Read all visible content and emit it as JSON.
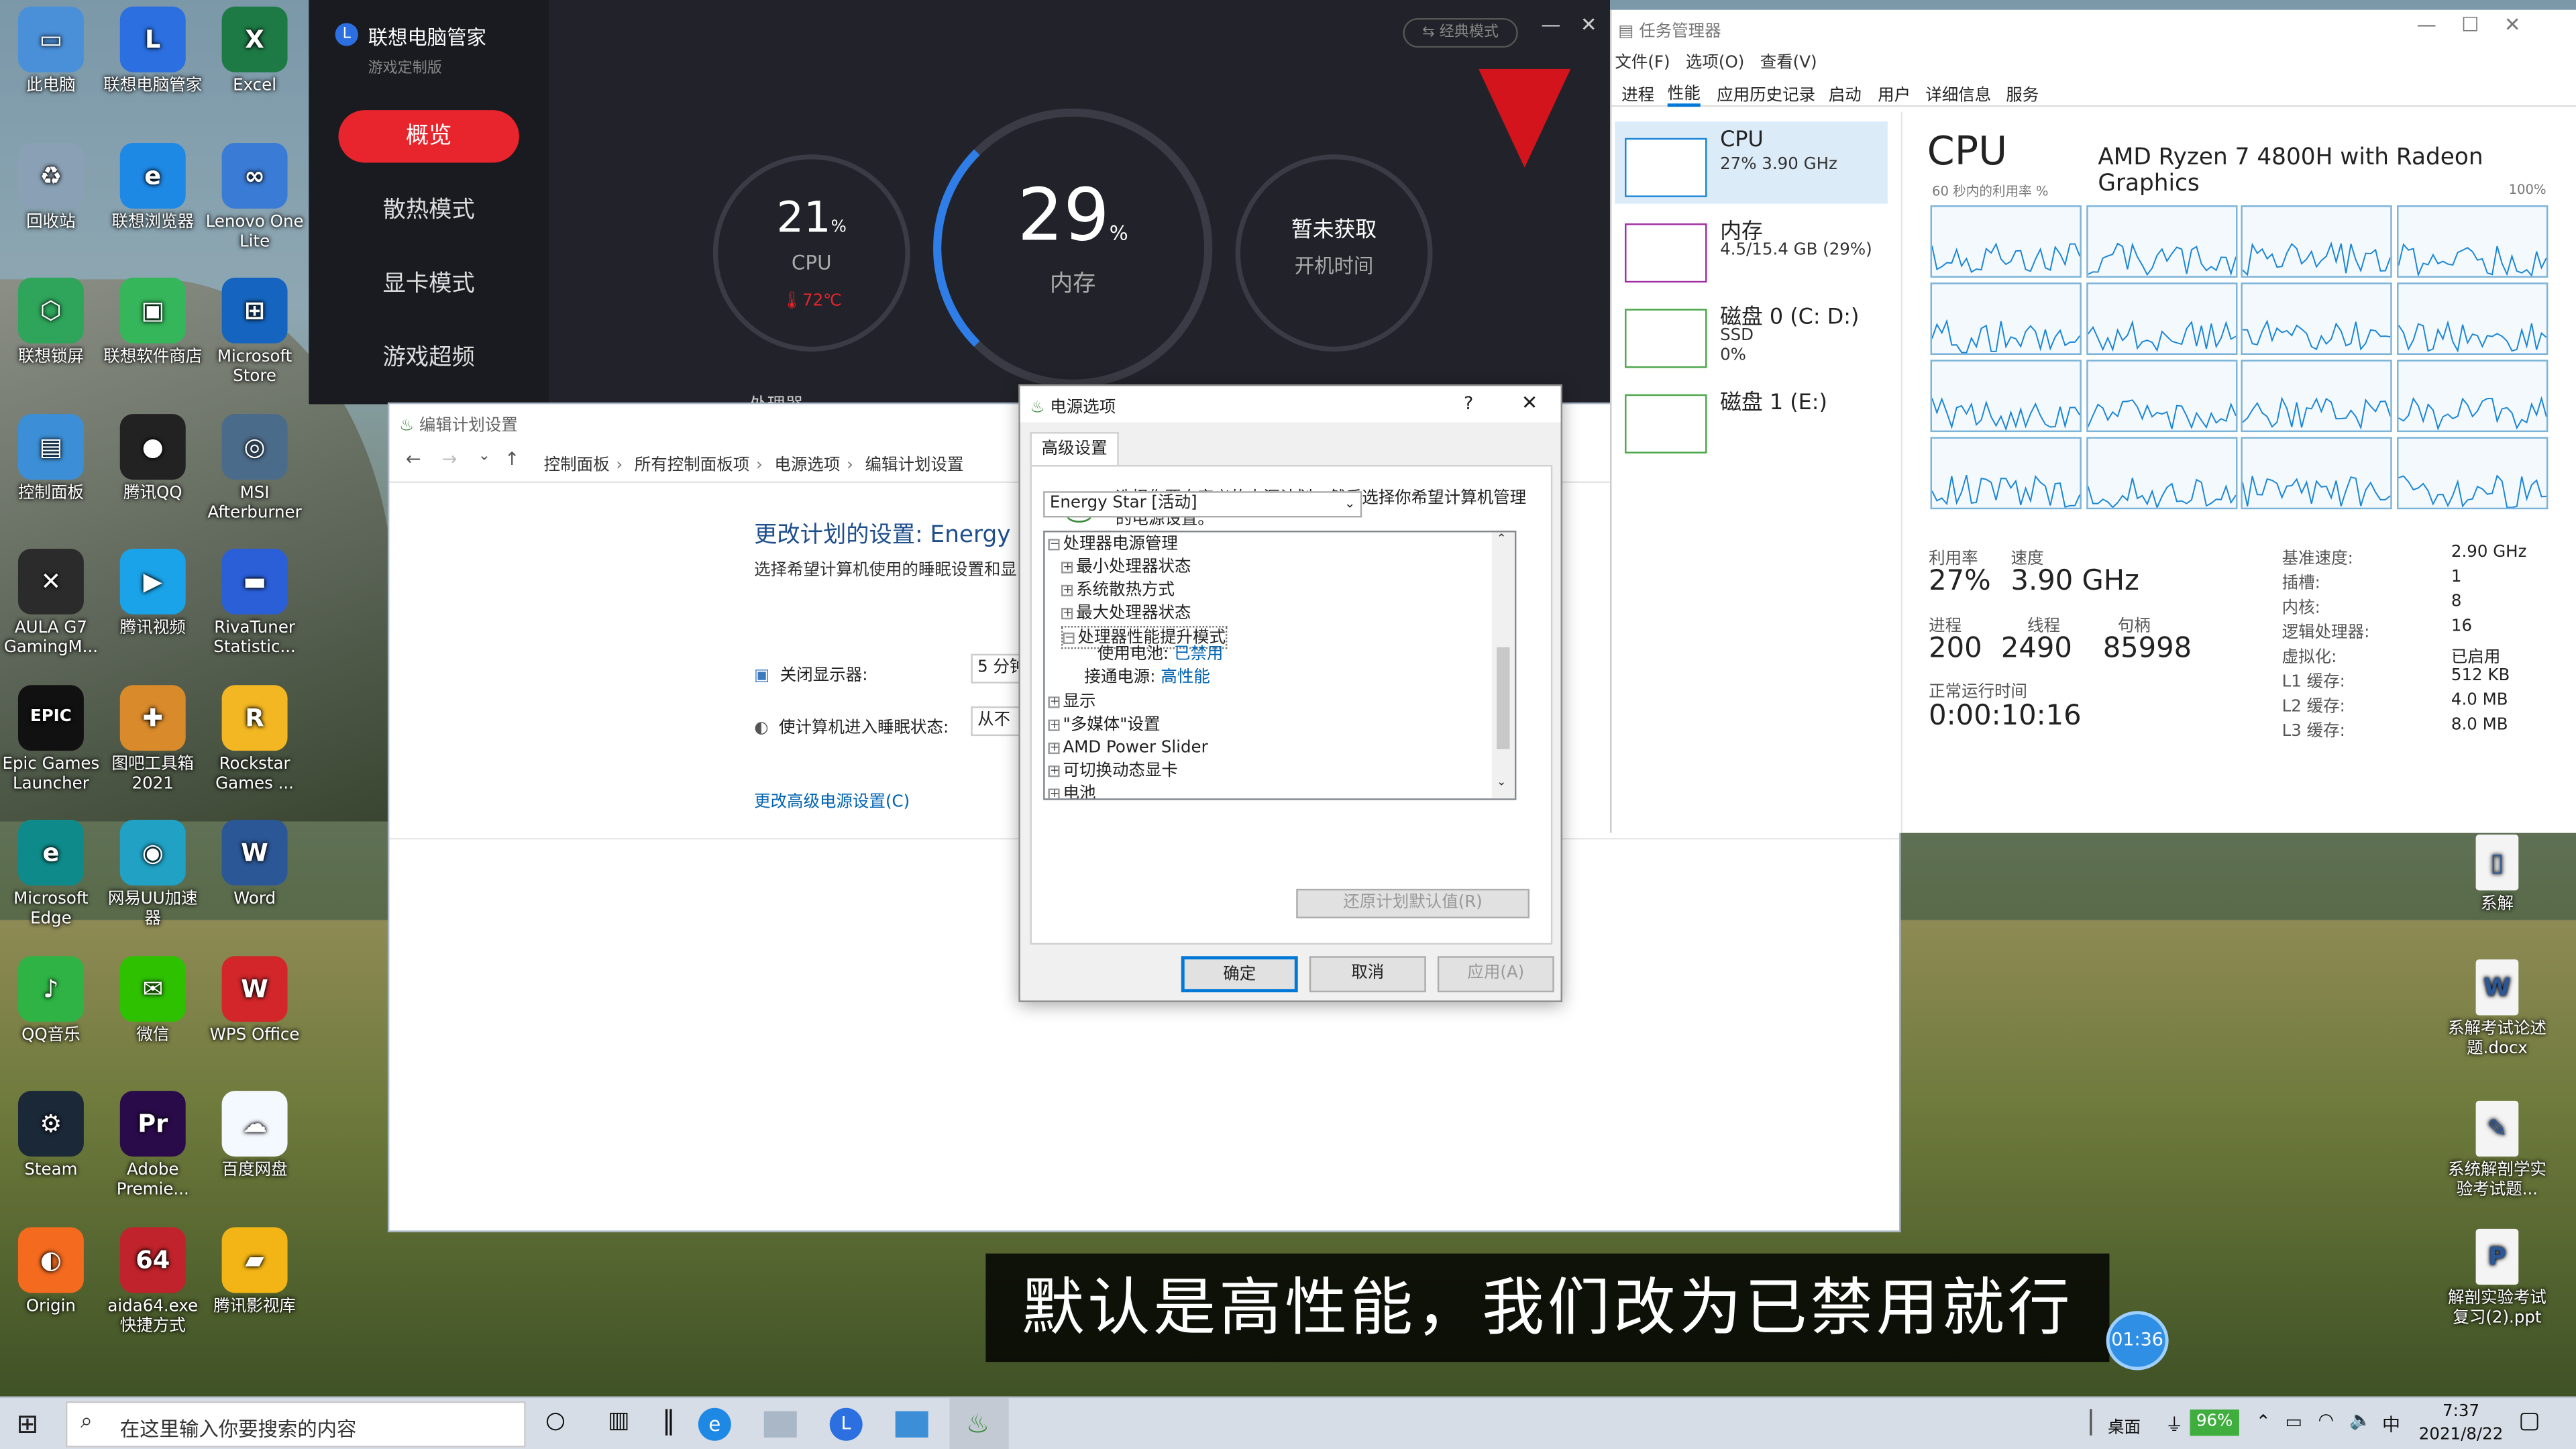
{
  "desktop_left": [
    {
      "label": "此电脑",
      "icon": "this-pc-icon",
      "color": "#4a90d9",
      "glyph": "▭"
    },
    {
      "label": "联想电脑管家",
      "icon": "lenovo-pcmanager-icon",
      "color": "#2b6fe0",
      "glyph": "L"
    },
    {
      "label": "Excel",
      "icon": "excel-icon",
      "color": "#1d7a44",
      "glyph": "X"
    },
    {
      "label": "回收站",
      "icon": "recycle-bin-icon",
      "color": "#8aa0b5",
      "glyph": "♻"
    },
    {
      "label": "联想浏览器",
      "icon": "lenovo-browser-icon",
      "color": "#1e88e5",
      "glyph": "e"
    },
    {
      "label": "Lenovo One Lite",
      "icon": "lenovo-one-icon",
      "color": "#3a7bd5",
      "glyph": "∞"
    },
    {
      "label": "联想锁屏",
      "icon": "lenovo-lock-icon",
      "color": "#2ea55a",
      "glyph": "⬡"
    },
    {
      "label": "联想软件商店",
      "icon": "lenovo-store-icon",
      "color": "#35b65a",
      "glyph": "▣"
    },
    {
      "label": "Microsoft Store",
      "icon": "ms-store-icon",
      "color": "#1565c0",
      "glyph": "⊞"
    },
    {
      "label": "控制面板",
      "icon": "control-panel-icon",
      "color": "#3c8fd6",
      "glyph": "▤"
    },
    {
      "label": "腾讯QQ",
      "icon": "qq-icon",
      "color": "#222",
      "glyph": "●"
    },
    {
      "label": "MSI Afterburner",
      "icon": "msi-afterburner-icon",
      "color": "#4b6b8a",
      "glyph": "◎"
    },
    {
      "label": "AULA G7 GamingM...",
      "icon": "aula-icon",
      "color": "#2b2b2b",
      "glyph": "✕"
    },
    {
      "label": "腾讯视频",
      "icon": "tencent-video-icon",
      "color": "#1aa3e8",
      "glyph": "▶"
    },
    {
      "label": "RivaTuner Statistic...",
      "icon": "rivatuner-icon",
      "color": "#2b5fd8",
      "glyph": "▬"
    },
    {
      "label": "Epic Games Launcher",
      "icon": "epic-games-icon",
      "color": "#111",
      "glyph": "EPIC"
    },
    {
      "label": "图吧工具箱2021",
      "icon": "toolbox-icon",
      "color": "#d98a2b",
      "glyph": "✚"
    },
    {
      "label": "Rockstar Games ...",
      "icon": "rockstar-icon",
      "color": "#f2b722",
      "glyph": "R"
    },
    {
      "label": "Microsoft Edge",
      "icon": "edge-icon",
      "color": "#0f8a8a",
      "glyph": "e"
    },
    {
      "label": "网易UU加速器",
      "icon": "uu-icon",
      "color": "#21a1c4",
      "glyph": "◉"
    },
    {
      "label": "Word",
      "icon": "word-icon",
      "color": "#2b5797",
      "glyph": "W"
    },
    {
      "label": "QQ音乐",
      "icon": "qq-music-icon",
      "color": "#2fb344",
      "glyph": "♪"
    },
    {
      "label": "微信",
      "icon": "wechat-icon",
      "color": "#2dc100",
      "glyph": "✉"
    },
    {
      "label": "WPS Office",
      "icon": "wps-icon",
      "color": "#d2262b",
      "glyph": "W"
    },
    {
      "label": "Steam",
      "icon": "steam-icon",
      "color": "#1b2838",
      "glyph": "⚙"
    },
    {
      "label": "Adobe Premie...",
      "icon": "premiere-icon",
      "color": "#2a0b4a",
      "glyph": "Pr"
    },
    {
      "label": "百度网盘",
      "icon": "baidu-pan-icon",
      "color": "#f4f8ff",
      "glyph": "☁"
    },
    {
      "label": "Origin",
      "icon": "origin-icon",
      "color": "#f46a1f",
      "glyph": "◐"
    },
    {
      "label": "aida64.exe 快捷方式",
      "icon": "aida64-icon",
      "color": "#c0232b",
      "glyph": "64"
    },
    {
      "label": "腾讯影视库",
      "icon": "tencent-library-icon",
      "color": "#f3b515",
      "glyph": "▰"
    }
  ],
  "desktop_right": [
    {
      "label": "系解",
      "icon": "folder-icon",
      "glyph": "▯"
    },
    {
      "label": "系解考试论述题.docx",
      "icon": "docx-icon",
      "glyph": "W"
    },
    {
      "label": "系统解剖学实验考试题...",
      "icon": "image-file-icon",
      "glyph": "✎"
    },
    {
      "label": "解剖实验考试复习(2).ppt",
      "icon": "ppt-icon",
      "glyph": "P"
    }
  ],
  "lenovo": {
    "title": "联想电脑管家",
    "subtitle": "游戏定制版",
    "classic_mode": "经典模式",
    "menu": [
      "概览",
      "散热模式",
      "显卡模式",
      "游戏超频"
    ],
    "cpu_value": "21",
    "cpu_unit": "%",
    "cpu_label": "CPU",
    "cpu_temp": "72℃",
    "mem_value": "29",
    "mem_unit": "%",
    "mem_label": "内存",
    "boot_value": "暂未获取",
    "boot_label": "开机时间",
    "processor_partial": "处理器"
  },
  "control_panel": {
    "title": "编辑计划设置",
    "breadcrumbs": [
      "控制面板",
      "所有控制面板项",
      "电源选项",
      "编辑计划设置"
    ],
    "heading": "更改计划的设置: Energy Sta",
    "desc": "选择希望计算机使用的睡眠设置和显",
    "display_off_label": "关闭显示器:",
    "display_off_value": "5 分钟",
    "sleep_label": "使计算机进入睡眠状态:",
    "sleep_value": "从不",
    "advanced_link": "更改高级电源设置(C)"
  },
  "power_dialog": {
    "title": "电源选项",
    "help": "?",
    "tab": "高级设置",
    "intro": "选择你要自定义的电源计划，然后选择你希望计算机管理的电源设置。",
    "plan": "Energy Star [活动]",
    "tree": [
      {
        "text": "处理器电源管理",
        "box": "−",
        "indent": 0
      },
      {
        "text": "最小处理器状态",
        "box": "+",
        "indent": 1
      },
      {
        "text": "系统散热方式",
        "box": "+",
        "indent": 1
      },
      {
        "text": "最大处理器状态",
        "box": "+",
        "indent": 1
      },
      {
        "text": "处理器性能提升模式",
        "box": "−",
        "indent": 1
      }
    ],
    "battery_label": "使用电池:",
    "battery_value": "已禁用",
    "ac_label": "接通电源:",
    "ac_value": "高性能",
    "tree2": [
      {
        "text": "显示",
        "box": "+"
      },
      {
        "text": "\"多媒体\"设置",
        "box": "+"
      },
      {
        "text": "AMD Power Slider",
        "box": "+"
      },
      {
        "text": "可切换动态显卡",
        "box": "+"
      },
      {
        "text": "电池",
        "box": "+"
      }
    ],
    "restore": "还原计划默认值(R)",
    "ok": "确定",
    "cancel": "取消",
    "apply": "应用(A)"
  },
  "task_manager": {
    "title": "任务管理器",
    "menu": [
      "文件(F)",
      "选项(O)",
      "查看(V)"
    ],
    "tabs": [
      "进程",
      "性能",
      "应用历史记录",
      "启动",
      "用户",
      "详细信息",
      "服务"
    ],
    "side": [
      {
        "name": "CPU",
        "line1": "27% 3.90 GHz",
        "line2": ""
      },
      {
        "name": "内存",
        "line1": "4.5/15.4 GB (29%)",
        "line2": ""
      },
      {
        "name": "磁盘 0 (C: D:)",
        "line1": "SSD",
        "line2": "0%"
      },
      {
        "name": "磁盘 1 (E:)",
        "line1": "",
        "line2": ""
      }
    ],
    "cpu_title": "CPU",
    "cpu_model": "AMD Ryzen 7 4800H with Radeon Graphics",
    "graph_caption": "60 秒内的利用率 %",
    "graph_max": "100%",
    "util_label": "利用率",
    "util_value": "27%",
    "speed_label": "速度",
    "speed_value": "3.90 GHz",
    "proc_label": "进程",
    "proc_value": "200",
    "thread_label": "线程",
    "thread_value": "2490",
    "handle_label": "句柄",
    "handle_value": "85998",
    "uptime_label": "正常运行时间",
    "uptime_value": "0:00:10:16",
    "specs": [
      [
        "基准速度:",
        "2.90 GHz"
      ],
      [
        "插槽:",
        "1"
      ],
      [
        "内核:",
        "8"
      ],
      [
        "逻辑处理器:",
        "16"
      ],
      [
        "虚拟化:",
        "已启用"
      ],
      [
        "L1 缓存:",
        "512 KB"
      ],
      [
        "L2 缓存:",
        "4.0 MB"
      ],
      [
        "L3 缓存:",
        "8.0 MB"
      ]
    ]
  },
  "subtitle": "默认是高性能，我们改为已禁用就行",
  "timer": "01:36",
  "taskbar": {
    "search_placeholder": "在这里输入你要搜索的内容",
    "desktop": "桌面",
    "battery": "96%",
    "ime": "中",
    "time": "7:37",
    "date": "2021/8/22"
  }
}
